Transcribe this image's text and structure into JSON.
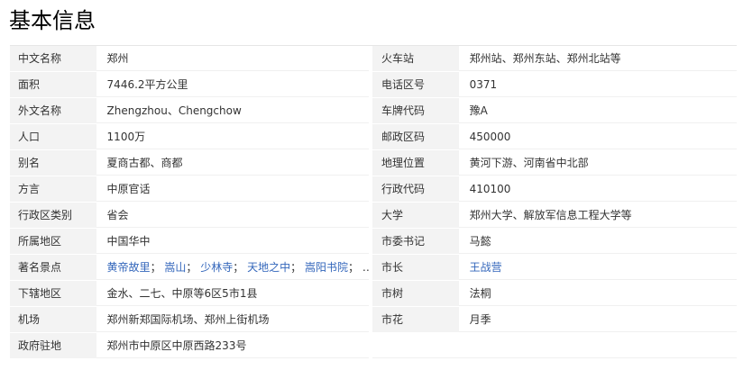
{
  "title": "基本信息",
  "rows": [
    {
      "k1": "中文名称",
      "v1": "郑州",
      "k2": "火车站",
      "v2": "郑州站、郑州东站、郑州北站等"
    },
    {
      "k1": "面积",
      "v1": "7446.2平方公里",
      "k2": "电话区号",
      "v2": "0371"
    },
    {
      "k1": "外文名称",
      "v1": "Zhengzhou、Chengchow",
      "k2": "车牌代码",
      "v2": "豫A"
    },
    {
      "k1": "人口",
      "v1": "1100万",
      "k2": "邮政区码",
      "v2": "450000"
    },
    {
      "k1": "别名",
      "v1": "夏商古都、商都",
      "k2": "地理位置",
      "v2": "黄河下游、河南省中北部"
    },
    {
      "k1": "方言",
      "v1": "中原官话",
      "k2": "行政代码",
      "v2": "410100"
    },
    {
      "k1": "行政区类别",
      "v1": "省会",
      "k2": "大学",
      "v2": "郑州大学、解放军信息工程大学等"
    },
    {
      "k1": "所属地区",
      "v1": "中国华中",
      "k2": "市委书记",
      "v2": "马懿"
    },
    {
      "k1": "著名景点",
      "v1": "",
      "k2": "市长",
      "v2": ""
    },
    {
      "k1": "下辖地区",
      "v1": "金水、二七、中原等6区5市1县",
      "k2": "市树",
      "v2": "法桐"
    },
    {
      "k1": "机场",
      "v1": "郑州新郑国际机场、郑州上街机场",
      "k2": "市花",
      "v2": "月季"
    },
    {
      "k1": "政府驻地",
      "v1": "郑州市中原区中原西路233号",
      "k2": "",
      "v2": ""
    }
  ],
  "attractions": {
    "items": [
      "黄帝故里",
      "嵩山",
      "少林寺",
      "天地之中",
      "嵩阳书院"
    ],
    "separator": "；",
    "ellipsis": "…"
  },
  "mayor": "王战营",
  "colors": {
    "key_bg": "#f3f3f3",
    "link": "#3366bb"
  }
}
